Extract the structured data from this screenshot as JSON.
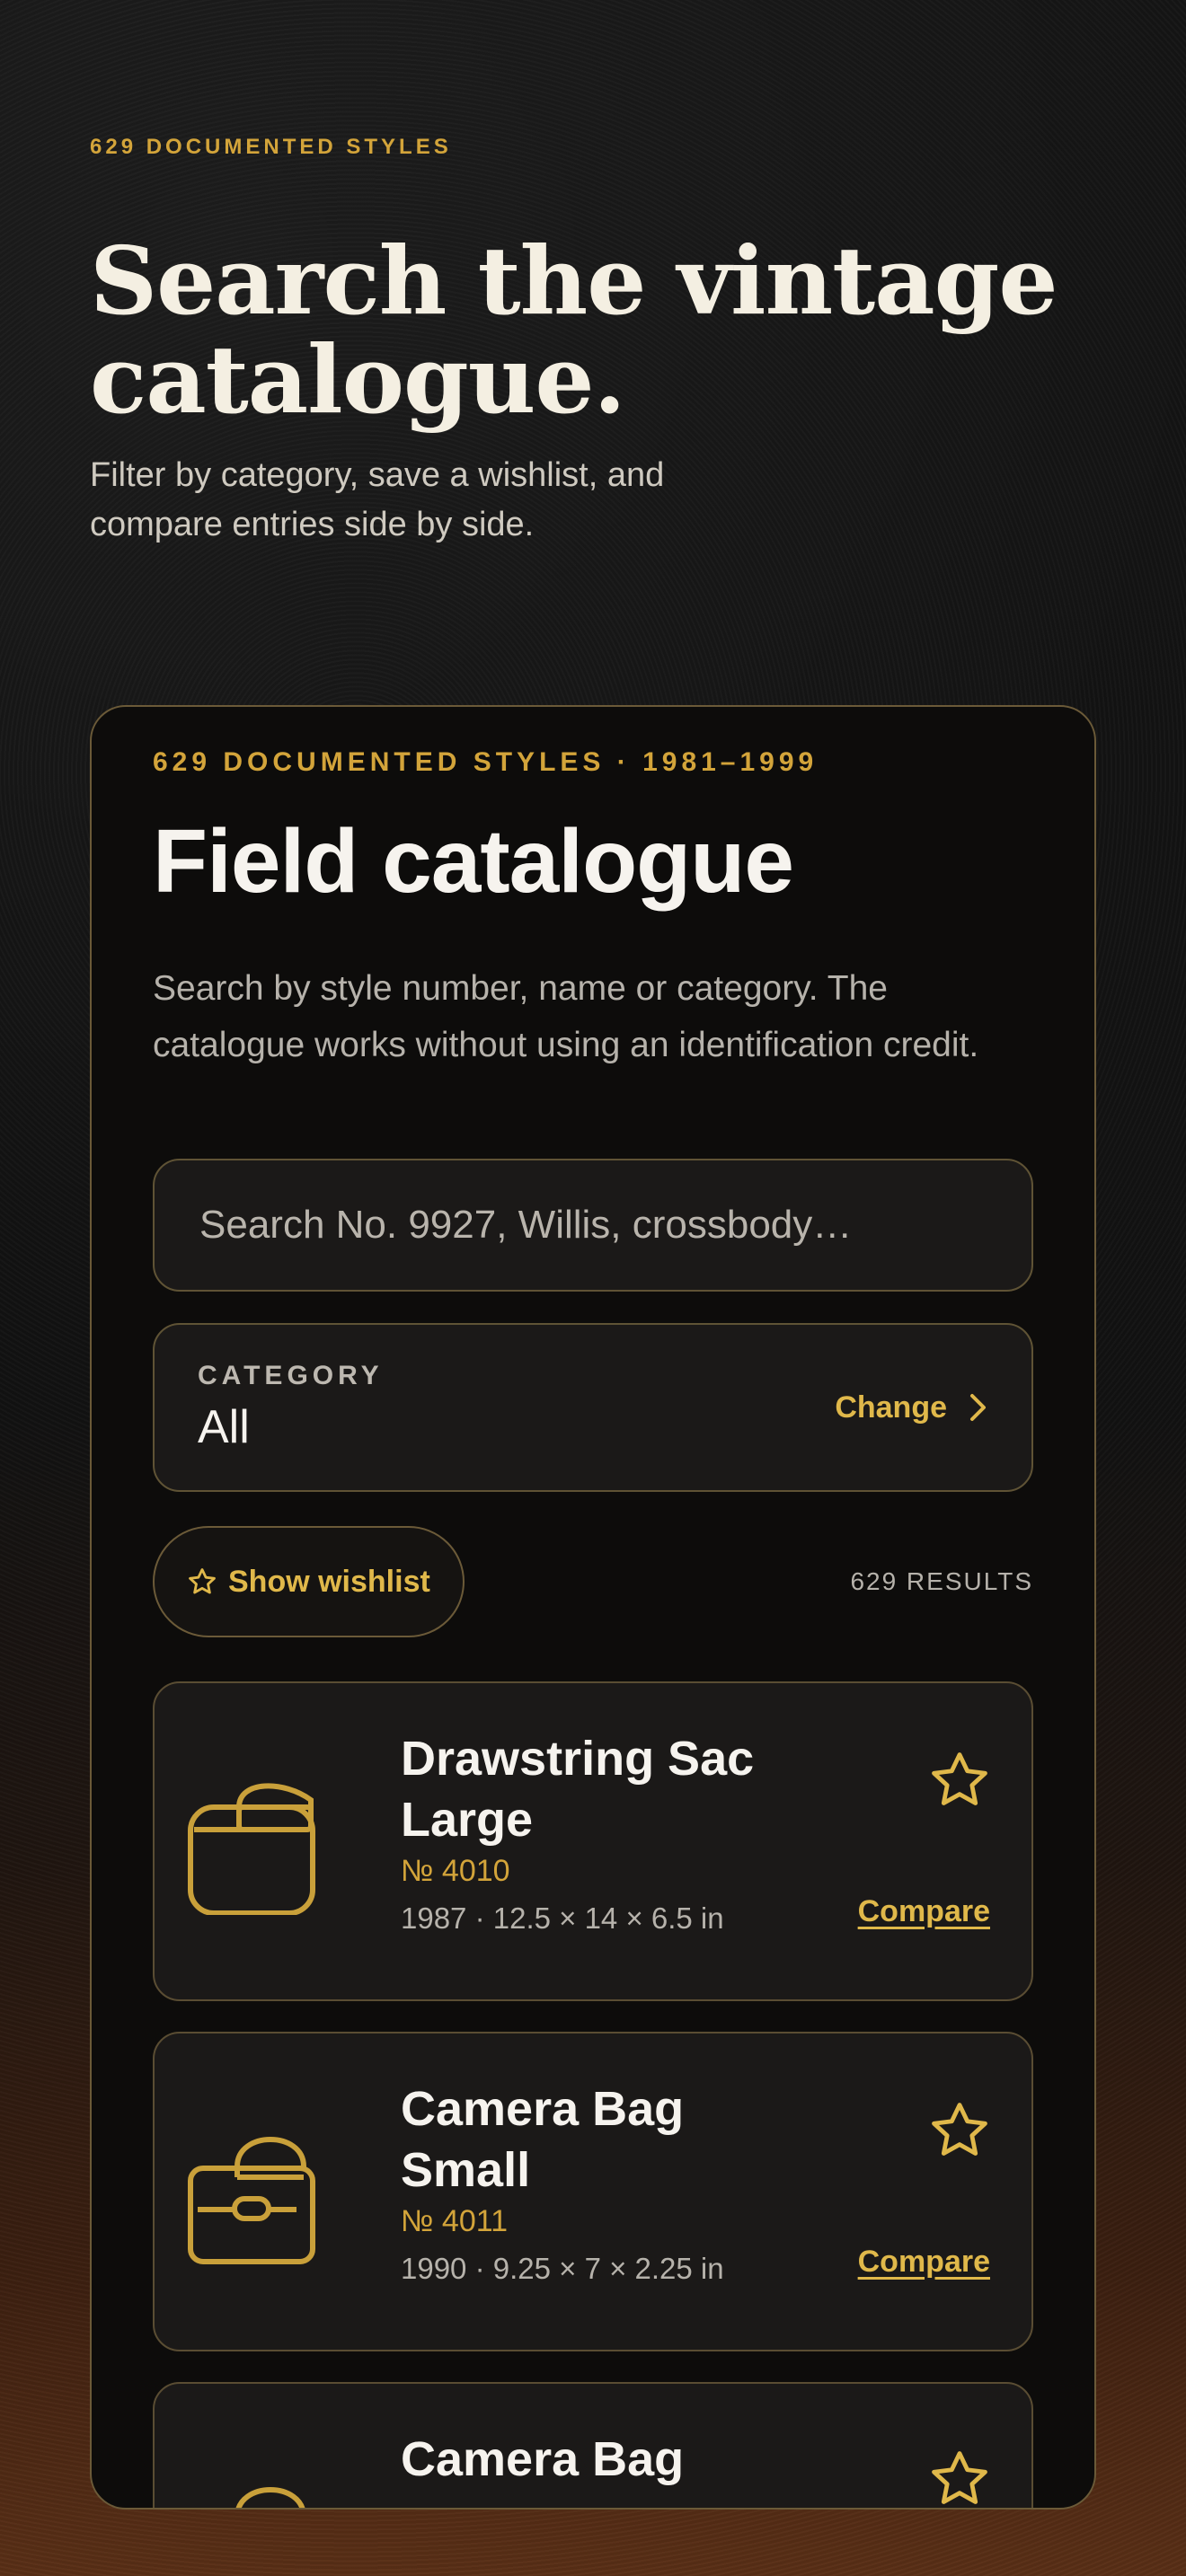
{
  "hero": {
    "eyebrow": "629 DOCUMENTED STYLES",
    "title": "Search the vintage catalogue.",
    "subtitle": "Filter by category, save a wishlist, and compare entries side by side."
  },
  "panel": {
    "eyebrow": "629 DOCUMENTED STYLES · 1981–1999",
    "title": "Field catalogue",
    "description": "Search by style number, name or category. The catalogue works without using an identification credit.",
    "search": {
      "placeholder": "Search No. 9927, Willis, crossbody…",
      "value": ""
    },
    "category": {
      "label": "CATEGORY",
      "value": "All",
      "action": "Change"
    },
    "wishlist_label": "Show wishlist",
    "results_count": "629 RESULTS",
    "items": [
      {
        "name": "Drawstring Sac Large",
        "number": "№ 4010",
        "meta": "1987 · 12.5 × 14 × 6.5 in",
        "compare": "Compare",
        "icon": "drawstring-bag-icon"
      },
      {
        "name": "Camera Bag Small",
        "number": "№ 4011",
        "meta": "1990 · 9.25 × 7 × 2.25 in",
        "compare": "Compare",
        "icon": "camera-bag-icon"
      },
      {
        "name": "Camera Bag",
        "number": "",
        "meta": "",
        "compare": "",
        "icon": "camera-bag-icon"
      }
    ]
  },
  "colors": {
    "accent": "#d3a43a",
    "panel": "#0d0c0b",
    "card": "#1b1918"
  }
}
